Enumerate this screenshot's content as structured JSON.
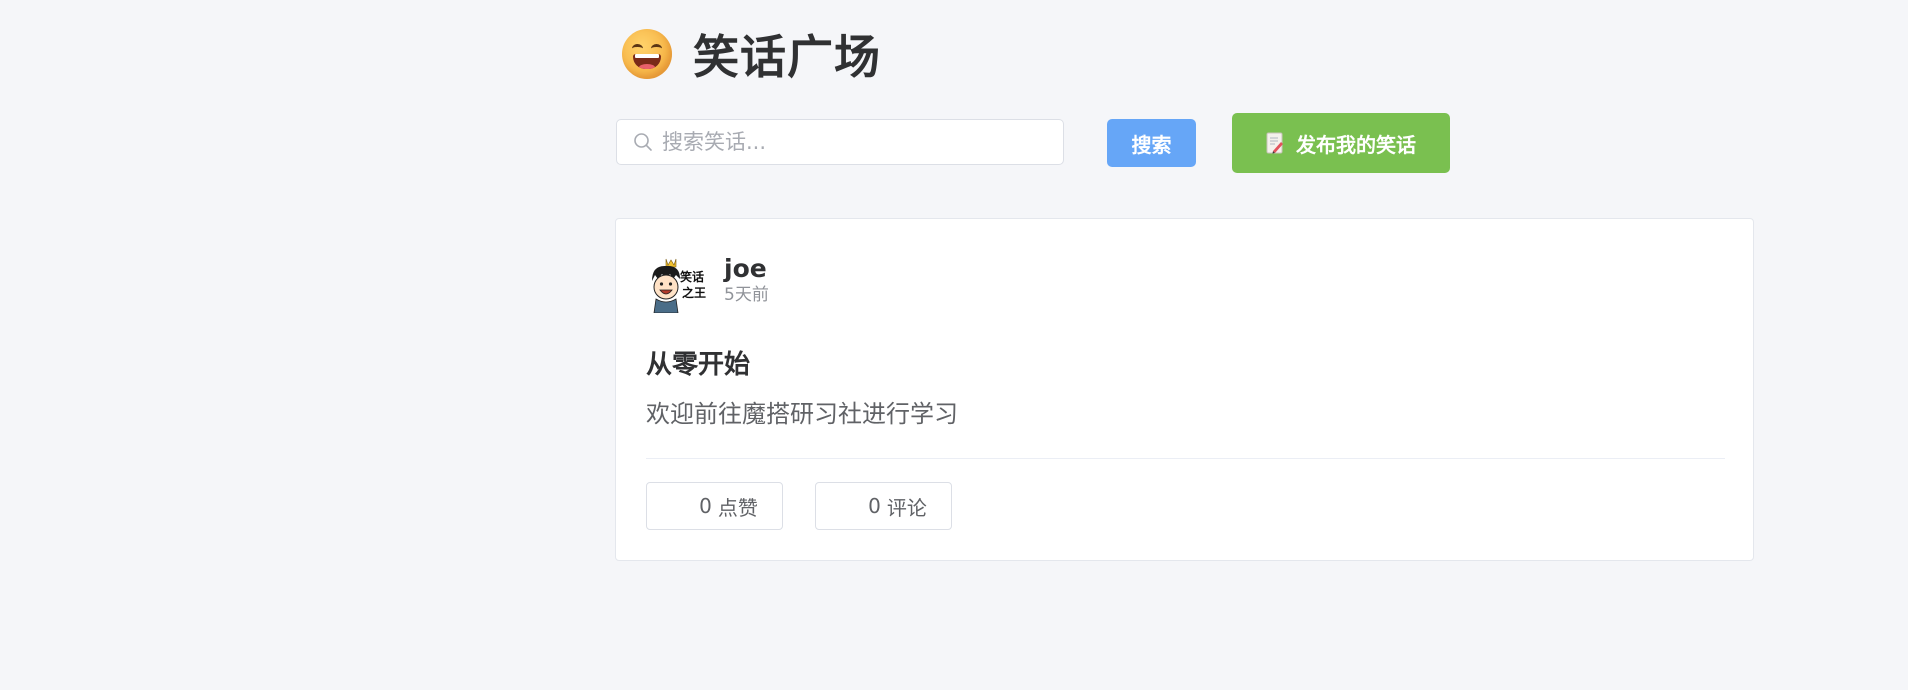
{
  "header": {
    "emoji_icon": "grinning-face-icon",
    "title": "笑话广场"
  },
  "search": {
    "icon": "search-icon",
    "placeholder": "搜索笑话...",
    "value": "",
    "button_label": "搜索"
  },
  "publish": {
    "icon": "memo-icon",
    "label": "发布我的笑话"
  },
  "post": {
    "author": {
      "avatar": "cartoon-avatar-icon",
      "name": "joe",
      "time": "5天前"
    },
    "title": "从零开始",
    "content": "欢迎前往魔搭研习社进行学习",
    "likes": {
      "count": "0",
      "label": "点赞"
    },
    "comments": {
      "count": "0",
      "label": "评论"
    }
  },
  "colors": {
    "background": "#f5f6f9",
    "search_button": "#66a6f7",
    "publish_button": "#7ac050",
    "card_border": "#e4e7ed"
  }
}
